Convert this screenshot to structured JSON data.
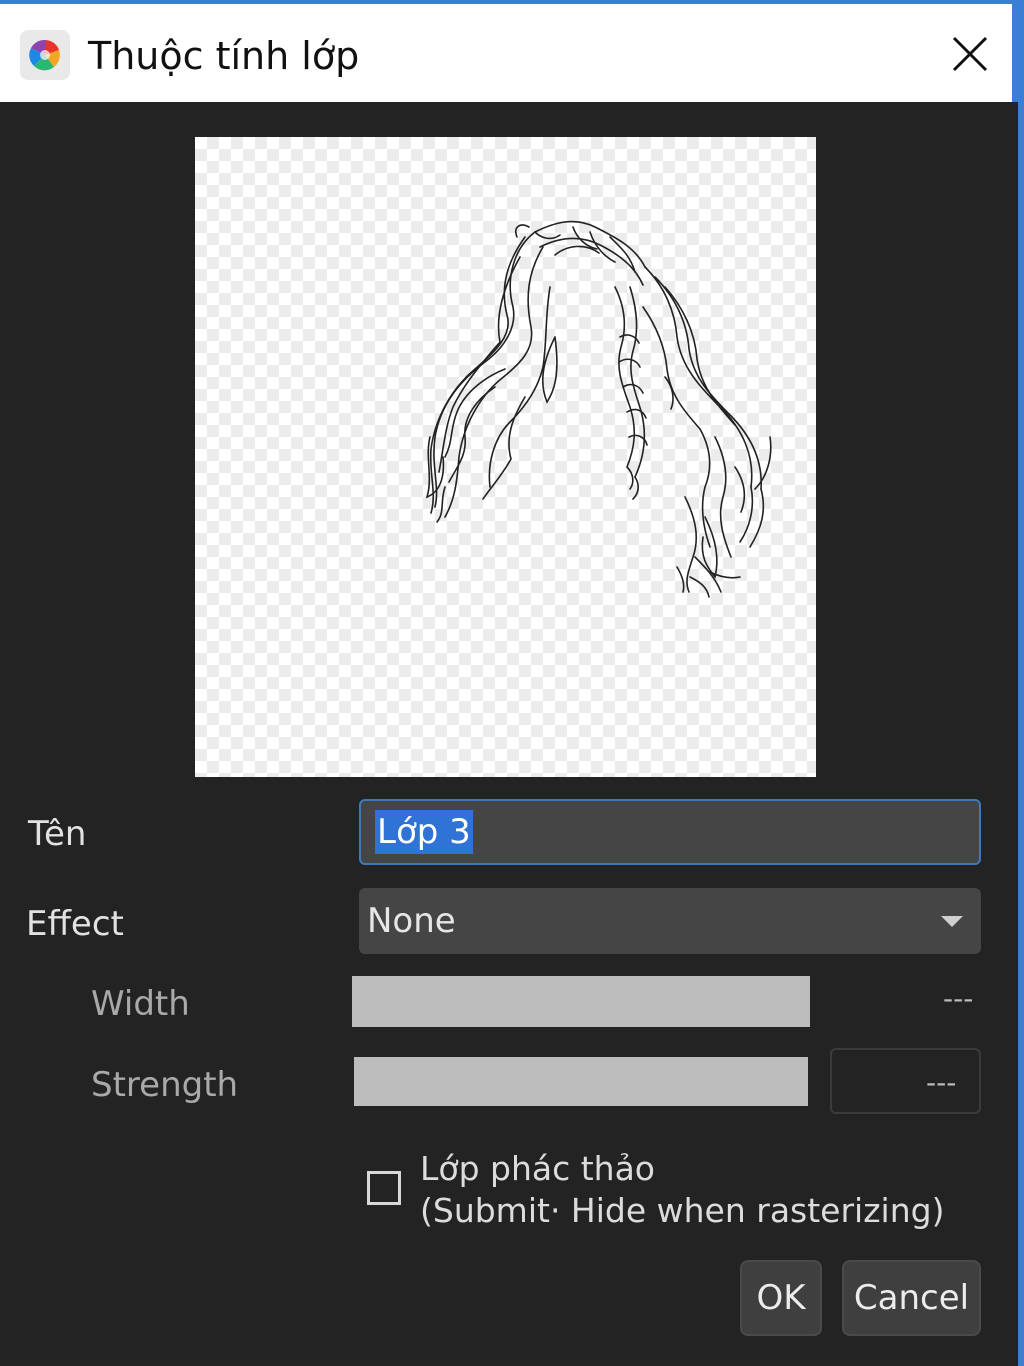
{
  "window": {
    "title": "Thuộc tính lớp",
    "close_icon": "close-icon",
    "app_icon": "medibang-logo-icon"
  },
  "form": {
    "name_label": "Tên",
    "name_value": "Lớp 3",
    "effect_label": "Effect",
    "effect_value": "None",
    "width_label": "Width",
    "width_value": "---",
    "strength_label": "Strength",
    "strength_value": "---",
    "draft_label": "Lớp phác thảo",
    "draft_sublabel": "(Submit· Hide when rasterizing)",
    "draft_checked": false
  },
  "buttons": {
    "ok": "OK",
    "cancel": "Cancel"
  },
  "colors": {
    "background": "#232323",
    "titlebar": "#ffffff",
    "accent": "#3a7fd5",
    "input": "#454545",
    "selection": "#2f73d6"
  }
}
